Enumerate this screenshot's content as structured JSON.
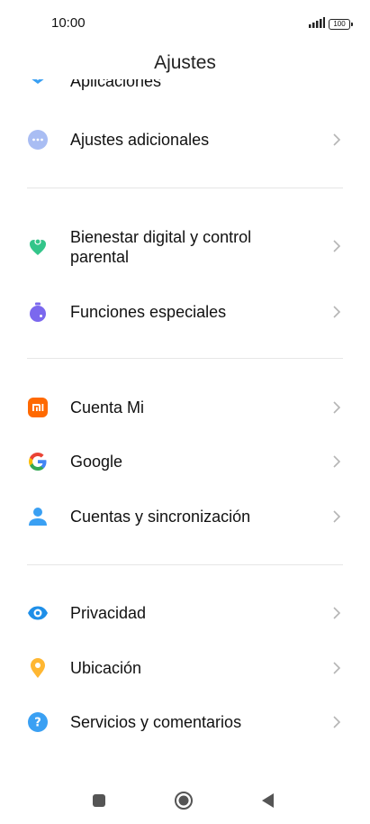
{
  "status_bar": {
    "time": "10:00",
    "battery": "100"
  },
  "header": {
    "title": "Ajustes"
  },
  "settings": {
    "partial_item": {
      "label": "Aplicaciones"
    },
    "items": [
      {
        "label": "Ajustes adicionales",
        "icon": "more-dots-icon"
      },
      {
        "label": "Bienestar digital y control parental",
        "icon": "digital-wellbeing-icon"
      },
      {
        "label": "Funciones especiales",
        "icon": "special-features-icon"
      },
      {
        "label": "Cuenta Mi",
        "icon": "mi-account-icon"
      },
      {
        "label": "Google",
        "icon": "google-icon"
      },
      {
        "label": "Cuentas y sincronización",
        "icon": "account-sync-icon"
      },
      {
        "label": "Privacidad",
        "icon": "privacy-eye-icon"
      },
      {
        "label": "Ubicación",
        "icon": "location-pin-icon"
      },
      {
        "label": "Servicios y comentarios",
        "icon": "help-question-icon"
      }
    ]
  },
  "colors": {
    "more_dots": "#a9bdf3",
    "wellbeing": "#33c58a",
    "special": "#7b68ee",
    "mi": "#ff6900",
    "account": "#3aa0f3",
    "privacy": "#1f8fe8",
    "location": "#ffb732",
    "help": "#3aa0f3"
  }
}
